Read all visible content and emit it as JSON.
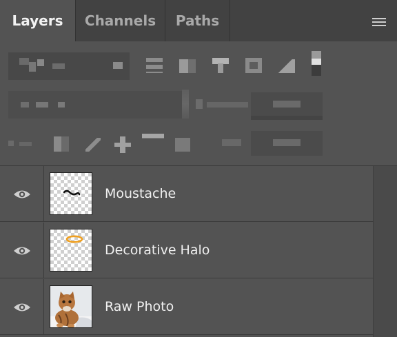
{
  "tabs": [
    {
      "label": "Layers",
      "active": true
    },
    {
      "label": "Channels",
      "active": false
    },
    {
      "label": "Paths",
      "active": false
    }
  ],
  "panel_menu_icon": "hamburger-menu-icon",
  "layers": [
    {
      "name": "Moustache",
      "visible": true,
      "thumbnail": "moustache-stroke-on-transparent"
    },
    {
      "name": "Decorative Halo",
      "visible": true,
      "thumbnail": "orange-halo-on-transparent"
    },
    {
      "name": "Raw Photo",
      "visible": true,
      "thumbnail": "cat-photo"
    }
  ],
  "colors": {
    "panel_bg": "#535353",
    "tabbar_bg": "#424242",
    "halo": "#f0a020"
  }
}
